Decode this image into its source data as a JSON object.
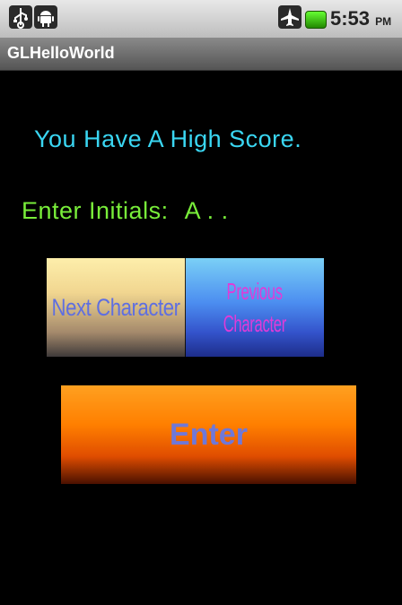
{
  "status_bar": {
    "time": "5:53",
    "ampm": "PM",
    "icons": [
      "usb-icon",
      "android-icon",
      "airplane-icon",
      "battery-icon"
    ],
    "battery_color": "#44cc22"
  },
  "app": {
    "title": "GLHelloWorld"
  },
  "game": {
    "high_score_text": "You Have A High Score.",
    "initials_label": "Enter Initials:",
    "initials_value": "A . ."
  },
  "buttons": {
    "next_character": "Next Character",
    "previous_line1": "Previous",
    "previous_line2": "Character",
    "enter": "Enter"
  },
  "colors": {
    "high_score": "#3ad6f2",
    "initials": "#79ee3a",
    "next_button_text": "#5f6fe0",
    "previous_button_text": "#e03bd8",
    "enter_button_text": "#6f78d8"
  }
}
